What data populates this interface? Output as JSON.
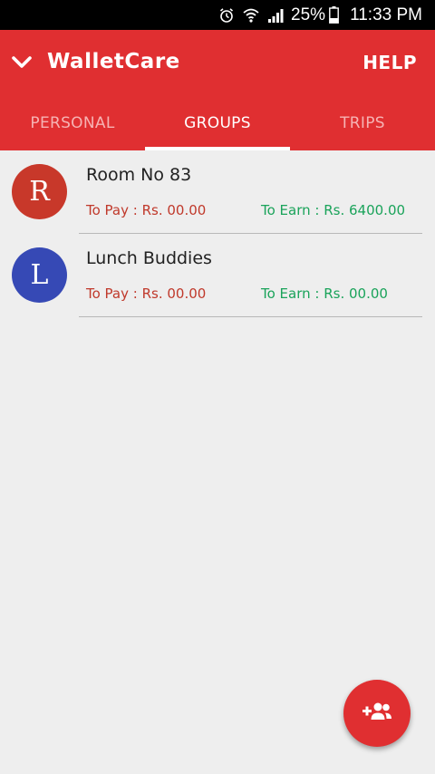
{
  "status_bar": {
    "battery": "25%",
    "time": "11:33 PM",
    "icons": [
      "alarm-icon",
      "wifi-icon",
      "signal-icon",
      "battery-icon"
    ]
  },
  "app_bar": {
    "title": "WalletCare",
    "help_label": "HELP",
    "color": "#e02f31"
  },
  "tabs": [
    {
      "label": "PERSONAL",
      "active": false
    },
    {
      "label": "GROUPS",
      "active": true
    },
    {
      "label": "TRIPS",
      "active": false
    }
  ],
  "groups": [
    {
      "initial": "R",
      "name": "Room No 83",
      "to_pay": "To Pay : Rs. 00.00",
      "to_earn": "To Earn : Rs. 6400.00",
      "avatar_color": "#c8382a"
    },
    {
      "initial": "L",
      "name": "Lunch Buddies",
      "to_pay": "To Pay : Rs. 00.00",
      "to_earn": "To Earn : Rs. 00.00",
      "avatar_color": "#3649b5"
    }
  ],
  "fab": {
    "icon": "add-group-icon"
  },
  "colors": {
    "pay": "#c0392b",
    "earn": "#1aa35a",
    "background": "#eeeeee"
  }
}
